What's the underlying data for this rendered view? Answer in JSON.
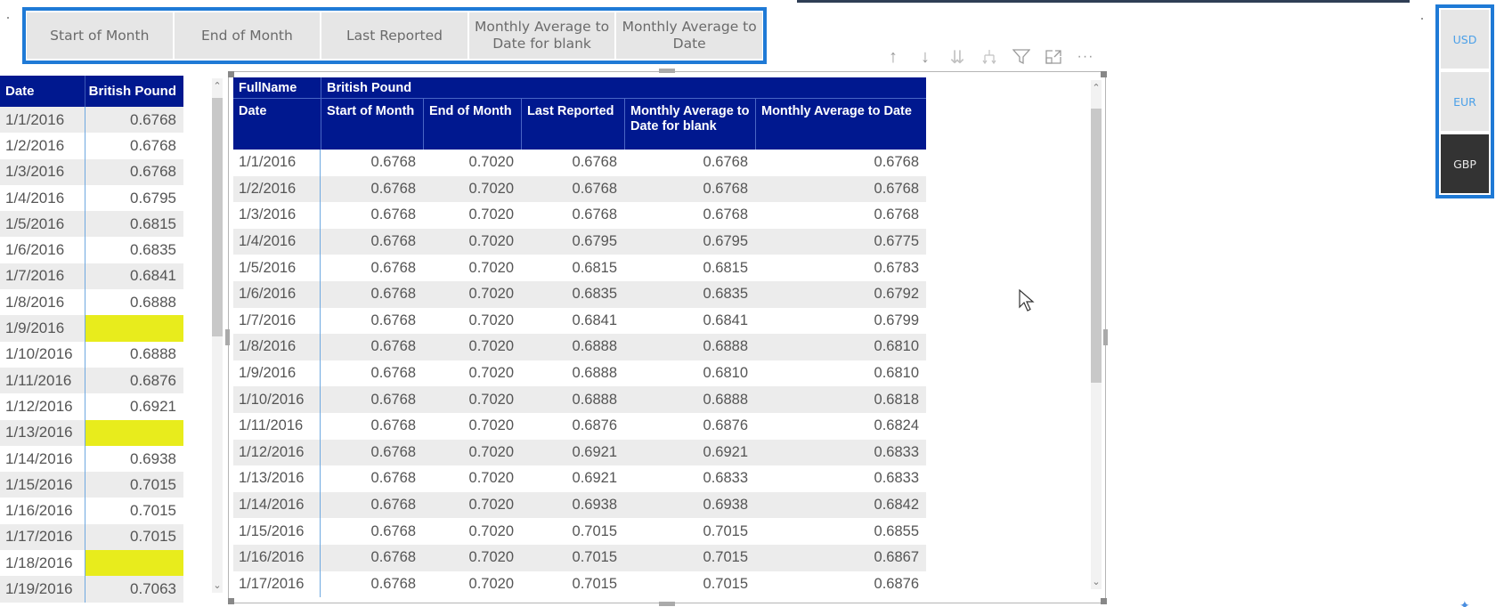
{
  "measure_slicer": {
    "options": [
      "Start of Month",
      "End of Month",
      "Last Reported",
      "Monthly Average to Date for blank",
      "Monthly Average to Date"
    ]
  },
  "currency_slicer": {
    "options": [
      "USD",
      "EUR",
      "GBP"
    ],
    "selected": "GBP"
  },
  "colors": {
    "table_header": "#00188f",
    "slicer_border": "#1f7ad6",
    "blank_highlight": "#e8ec1c",
    "selected_currency": "#333333"
  },
  "toolbar": {
    "icons": [
      "arrow-up-icon",
      "arrow-down-icon",
      "double-arrow-down-icon",
      "expand-hierarchy-icon",
      "filter-icon",
      "focus-mode-icon",
      "more-options-icon"
    ]
  },
  "left_table": {
    "headers": [
      "Date",
      "British Pound"
    ],
    "rows": [
      [
        "1/1/2016",
        "0.6768"
      ],
      [
        "1/2/2016",
        "0.6768"
      ],
      [
        "1/3/2016",
        "0.6768"
      ],
      [
        "1/4/2016",
        "0.6795"
      ],
      [
        "1/5/2016",
        "0.6815"
      ],
      [
        "1/6/2016",
        "0.6835"
      ],
      [
        "1/7/2016",
        "0.6841"
      ],
      [
        "1/8/2016",
        "0.6888"
      ],
      [
        "1/9/2016",
        ""
      ],
      [
        "1/10/2016",
        "0.6888"
      ],
      [
        "1/11/2016",
        "0.6876"
      ],
      [
        "1/12/2016",
        "0.6921"
      ],
      [
        "1/13/2016",
        ""
      ],
      [
        "1/14/2016",
        "0.6938"
      ],
      [
        "1/15/2016",
        "0.7015"
      ],
      [
        "1/16/2016",
        "0.7015"
      ],
      [
        "1/17/2016",
        "0.7015"
      ],
      [
        "1/18/2016",
        ""
      ],
      [
        "1/19/2016",
        "0.7063"
      ]
    ]
  },
  "main_table": {
    "group_header": {
      "label": "FullName",
      "value": "British Pound"
    },
    "headers": [
      "Date",
      "Start of Month",
      "End of Month",
      "Last Reported",
      "Monthly Average to Date for blank",
      "Monthly Average to Date"
    ],
    "rows": [
      [
        "1/1/2016",
        "0.6768",
        "0.7020",
        "0.6768",
        "0.6768",
        "0.6768"
      ],
      [
        "1/2/2016",
        "0.6768",
        "0.7020",
        "0.6768",
        "0.6768",
        "0.6768"
      ],
      [
        "1/3/2016",
        "0.6768",
        "0.7020",
        "0.6768",
        "0.6768",
        "0.6768"
      ],
      [
        "1/4/2016",
        "0.6768",
        "0.7020",
        "0.6795",
        "0.6795",
        "0.6775"
      ],
      [
        "1/5/2016",
        "0.6768",
        "0.7020",
        "0.6815",
        "0.6815",
        "0.6783"
      ],
      [
        "1/6/2016",
        "0.6768",
        "0.7020",
        "0.6835",
        "0.6835",
        "0.6792"
      ],
      [
        "1/7/2016",
        "0.6768",
        "0.7020",
        "0.6841",
        "0.6841",
        "0.6799"
      ],
      [
        "1/8/2016",
        "0.6768",
        "0.7020",
        "0.6888",
        "0.6888",
        "0.6810"
      ],
      [
        "1/9/2016",
        "0.6768",
        "0.7020",
        "0.6888",
        "0.6810",
        "0.6810"
      ],
      [
        "1/10/2016",
        "0.6768",
        "0.7020",
        "0.6888",
        "0.6888",
        "0.6818"
      ],
      [
        "1/11/2016",
        "0.6768",
        "0.7020",
        "0.6876",
        "0.6876",
        "0.6824"
      ],
      [
        "1/12/2016",
        "0.6768",
        "0.7020",
        "0.6921",
        "0.6921",
        "0.6833"
      ],
      [
        "1/13/2016",
        "0.6768",
        "0.7020",
        "0.6921",
        "0.6833",
        "0.6833"
      ],
      [
        "1/14/2016",
        "0.6768",
        "0.7020",
        "0.6938",
        "0.6938",
        "0.6842"
      ],
      [
        "1/15/2016",
        "0.6768",
        "0.7020",
        "0.7015",
        "0.7015",
        "0.6855"
      ],
      [
        "1/16/2016",
        "0.6768",
        "0.7020",
        "0.7015",
        "0.7015",
        "0.6867"
      ],
      [
        "1/17/2016",
        "0.6768",
        "0.7020",
        "0.7015",
        "0.7015",
        "0.6876"
      ]
    ]
  }
}
